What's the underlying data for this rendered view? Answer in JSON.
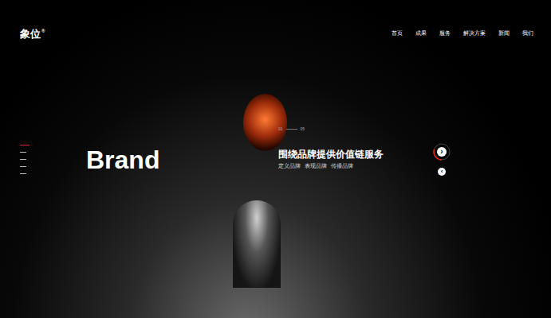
{
  "logo": {
    "text": "象位",
    "mark": "®"
  },
  "nav": [
    {
      "label": "首页"
    },
    {
      "label": "成果"
    },
    {
      "label": "服务"
    },
    {
      "label": "解决方案"
    },
    {
      "label": "新闻"
    },
    {
      "label": "我们"
    }
  ],
  "slider": {
    "indicators": [
      {
        "selected": true
      },
      {
        "selected": false
      },
      {
        "selected": false
      },
      {
        "selected": false
      },
      {
        "selected": false
      }
    ],
    "counter_start": "01",
    "counter_end": "05",
    "title": "Brand",
    "headline": "围绕品牌提供价值链服务",
    "tags": [
      "定义品牌",
      "表现品牌",
      "传播品牌"
    ],
    "next": "›",
    "prev": "‹",
    "level": 0.3
  }
}
